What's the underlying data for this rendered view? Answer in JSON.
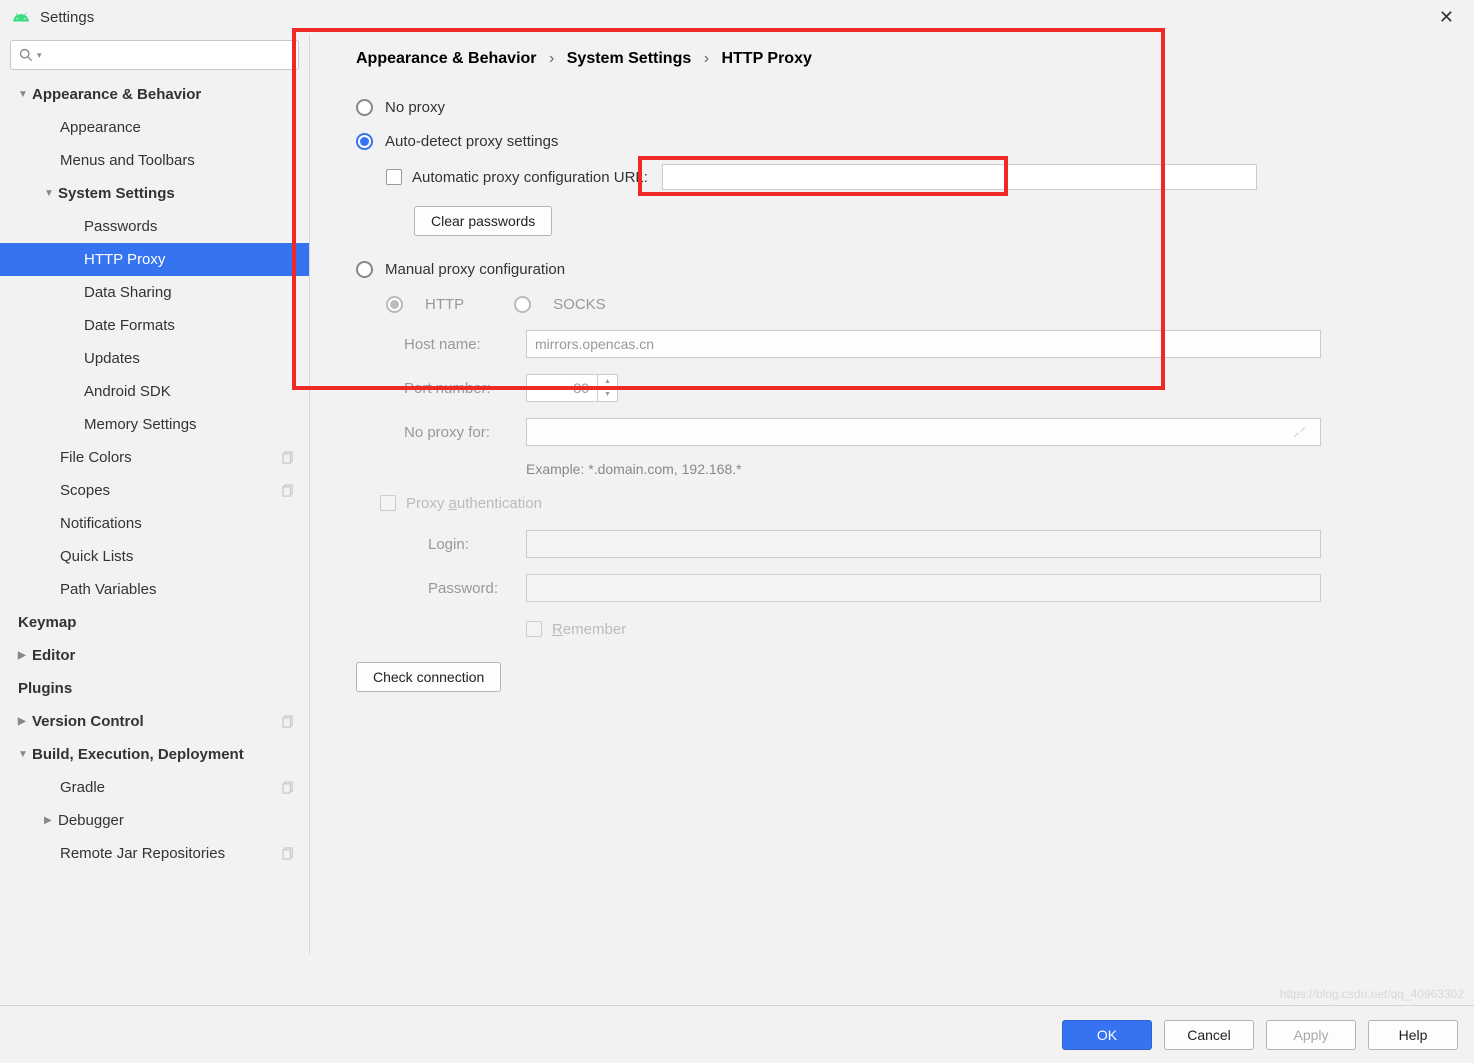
{
  "window": {
    "title": "Settings"
  },
  "sidebar": {
    "items": [
      {
        "label": "Appearance & Behavior",
        "bold": true,
        "arrow": "▼",
        "indent": 0
      },
      {
        "label": "Appearance",
        "indent": 1
      },
      {
        "label": "Menus and Toolbars",
        "indent": 1
      },
      {
        "label": "System Settings",
        "bold": true,
        "arrow": "▼",
        "indent": 1,
        "indentpx": 44
      },
      {
        "label": "Passwords",
        "indent": 2
      },
      {
        "label": "HTTP Proxy",
        "indent": 2,
        "selected": true
      },
      {
        "label": "Data Sharing",
        "indent": 2
      },
      {
        "label": "Date Formats",
        "indent": 2
      },
      {
        "label": "Updates",
        "indent": 2
      },
      {
        "label": "Android SDK",
        "indent": 2
      },
      {
        "label": "Memory Settings",
        "indent": 2
      },
      {
        "label": "File Colors",
        "indent": 1,
        "copy": true
      },
      {
        "label": "Scopes",
        "indent": 1,
        "copy": true
      },
      {
        "label": "Notifications",
        "indent": 1
      },
      {
        "label": "Quick Lists",
        "indent": 1
      },
      {
        "label": "Path Variables",
        "indent": 1
      },
      {
        "label": "Keymap",
        "bold": true,
        "indent": 0,
        "noarrow": true
      },
      {
        "label": "Editor",
        "bold": true,
        "arrow": "▶",
        "indent": 0
      },
      {
        "label": "Plugins",
        "bold": true,
        "indent": 0,
        "noarrow": true
      },
      {
        "label": "Version Control",
        "bold": true,
        "arrow": "▶",
        "indent": 0,
        "copy": true
      },
      {
        "label": "Build, Execution, Deployment",
        "bold": true,
        "arrow": "▼",
        "indent": 0
      },
      {
        "label": "Gradle",
        "indent": 1,
        "copy": true
      },
      {
        "label": "Debugger",
        "indent": 1,
        "arrow": "▶",
        "indentpx": 44
      },
      {
        "label": "Remote Jar Repositories",
        "indent": 1,
        "copy": true
      }
    ]
  },
  "breadcrumb": {
    "a": "Appearance & Behavior",
    "b": "System Settings",
    "c": "HTTP Proxy"
  },
  "proxy": {
    "no_proxy": "No proxy",
    "auto_detect": "Auto-detect proxy settings",
    "auto_url_label": "Automatic proxy configuration URL:",
    "clear_passwords": "Clear passwords",
    "manual": "Manual proxy configuration",
    "http": "HTTP",
    "socks": "SOCKS",
    "host_label": "Host name:",
    "host_value": "mirrors.opencas.cn",
    "port_label": "Port number:",
    "port_value": "80",
    "no_proxy_for_label": "No proxy for:",
    "example": "Example: *.domain.com, 192.168.*",
    "auth_label": "Proxy authentication",
    "login_label": "Login:",
    "password_label": "Password:",
    "remember_label": "Remember",
    "check_connection": "Check connection"
  },
  "footer": {
    "ok": "OK",
    "cancel": "Cancel",
    "apply": "Apply",
    "help": "Help"
  }
}
